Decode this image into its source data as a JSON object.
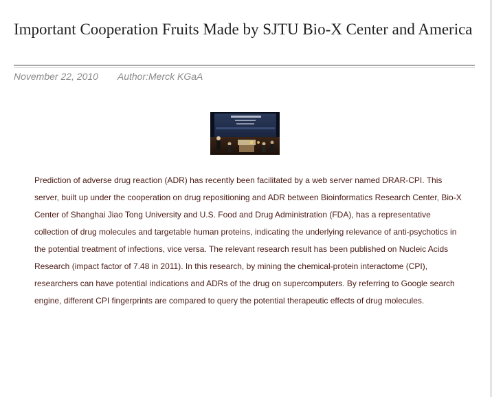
{
  "article": {
    "title": "Important Cooperation Fruits Made by SJTU Bio-X Center and America",
    "date": "November 22, 2010",
    "author": "Author:Merck KGaA",
    "body": "Prediction of adverse drug reaction (ADR) has recently been facilitated by a web server named DRAR-CPI. This server, built up under the cooperation on drug repositioning and ADR between Bioinformatics Research Center, Bio-X Center of Shanghai Jiao Tong University and U.S. Food and Drug Administration (FDA), has a representative collection of drug molecules and targetable human proteins, indicating the underlying relevance of anti-psychotics in the potential treatment of infections, vice versa. The relevant research result has been published on Nucleic Acids Research (impact factor of 7.48 in 2011). In this research, by mining the chemical-protein interactome (CPI), researchers can have potential indications and ADRs of the drug on supercomputers. By referring to Google search engine, different CPI fingerprints are compared to query the potential therapeutic effects of drug molecules."
  },
  "colors": {
    "title": "#1f1f1f",
    "meta": "#8a8a8a",
    "body_text": "#4a1a14",
    "divider": "#a8a8a8"
  },
  "image": {
    "description_icon": "conference-photo"
  }
}
